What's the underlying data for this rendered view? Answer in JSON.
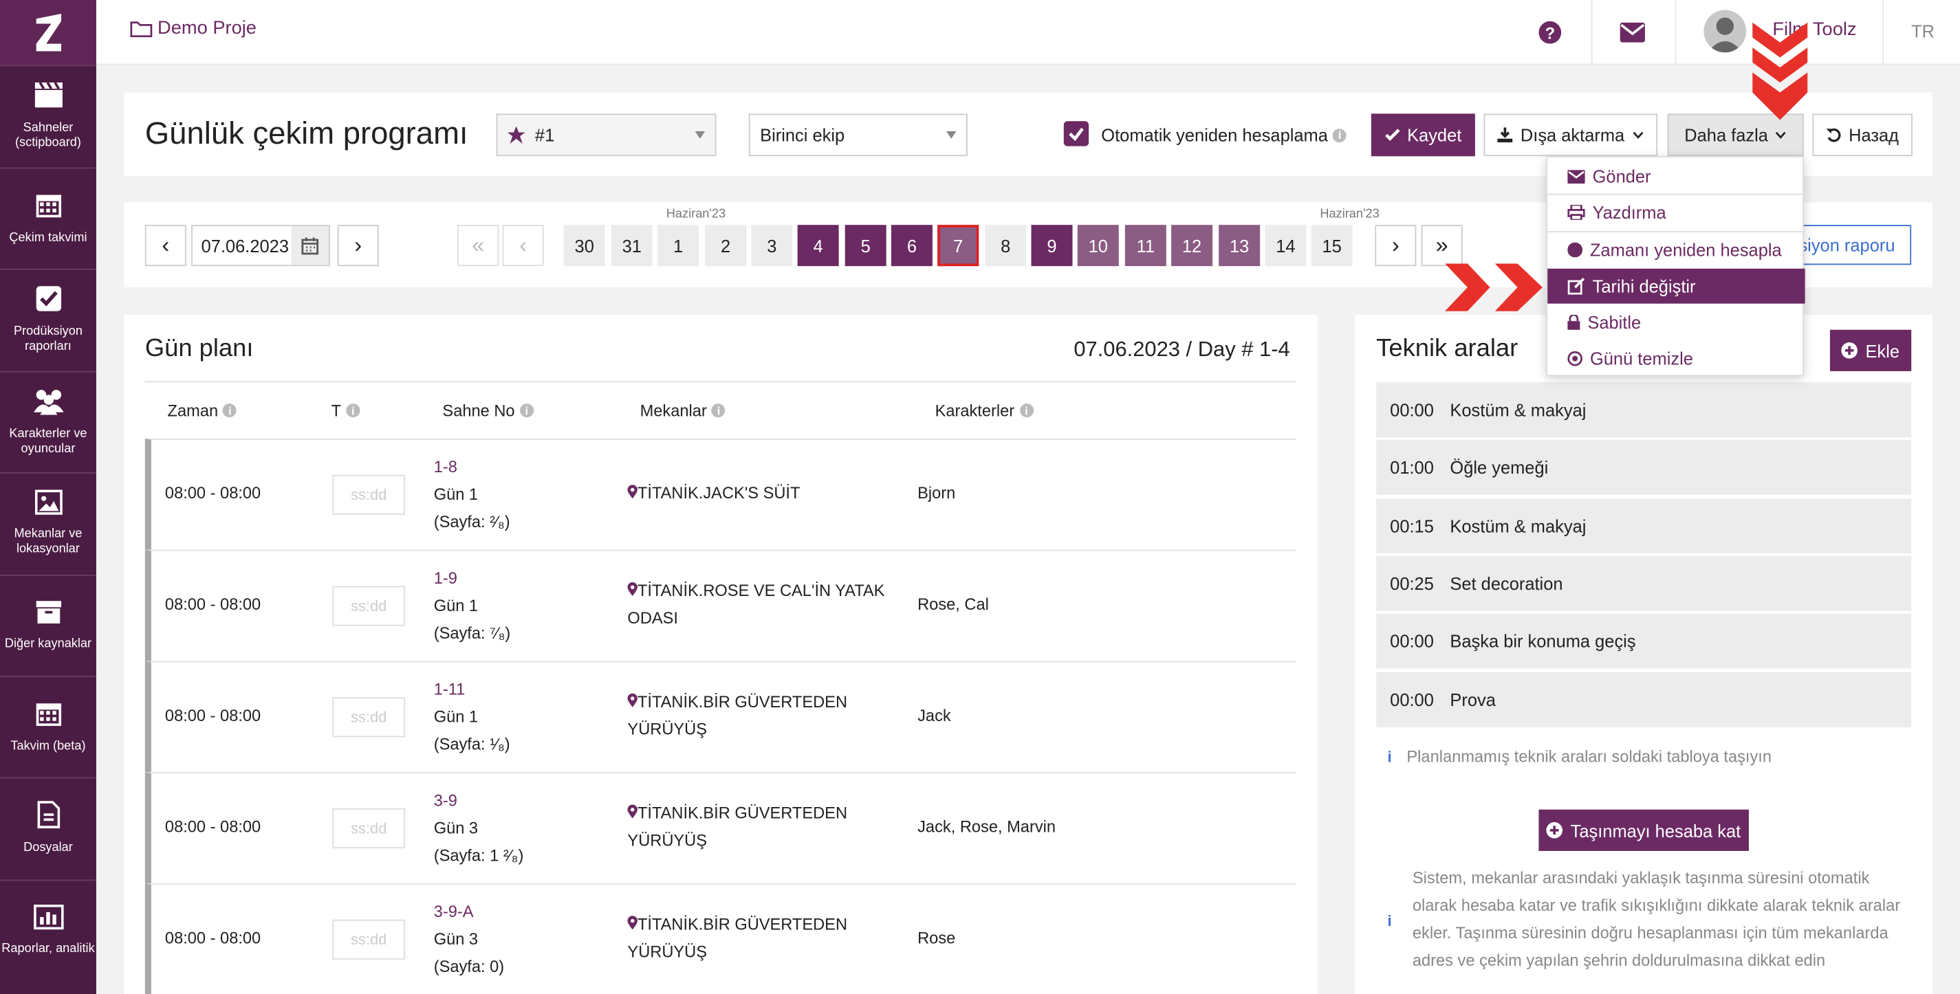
{
  "sidebar": {
    "items": [
      {
        "label": "Sahneler (sctipboard)",
        "icon": "clapperboard-icon"
      },
      {
        "label": "Çekim takvimi",
        "icon": "calendar-icon"
      },
      {
        "label": "Prodüksiyon raporları",
        "icon": "checkbox-icon"
      },
      {
        "label": "Karakterler ve oyuncular",
        "icon": "people-icon"
      },
      {
        "label": "Mekanlar ve lokasyonlar",
        "icon": "image-icon"
      },
      {
        "label": "Diğer kaynaklar",
        "icon": "archive-icon"
      },
      {
        "label": "Takvim (beta)",
        "icon": "calendar-icon"
      },
      {
        "label": "Dosyalar",
        "icon": "file-icon"
      },
      {
        "label": "Raporlar, analitik",
        "icon": "bar-chart-icon"
      }
    ]
  },
  "topbar": {
    "project": "Demo Proje",
    "user": "Film Toolz",
    "lang": "TR"
  },
  "header": {
    "title": "Günlük çekim programı",
    "schedule_select": "#1",
    "team_select": "Birinci ekip",
    "auto_label": "Otomatik yeniden hesaplama",
    "save": "Kaydet",
    "export": "Dışa aktarma",
    "more": "Daha fazla",
    "back": "Назад"
  },
  "dropdown": {
    "items": [
      "Gönder",
      "Yazdırma",
      "Zamanı yeniden hesapla",
      "Tarihi değiştir",
      "Sabitle",
      "Günü temizle"
    ]
  },
  "dates": {
    "date_value": "07.06.2023",
    "month1": "Haziran'23",
    "month2": "Haziran'23",
    "days": [
      "30",
      "31",
      "1",
      "2",
      "3",
      "4",
      "5",
      "6",
      "7",
      "8",
      "9",
      "10",
      "11",
      "12",
      "13",
      "14",
      "15"
    ],
    "report_link": "siyon raporu"
  },
  "plan": {
    "title": "Gün planı",
    "date_day": "07.06.2023 / Day # 1-4",
    "cols": [
      "Zaman",
      "T",
      "Sahne No",
      "Mekanlar",
      "Karakterler"
    ],
    "time_placeholder": "ss:dd",
    "rows": [
      {
        "time": "08:00 - 08:00",
        "scene": "1-8",
        "day": "Gün 1",
        "page": "(Sayfa: ²⁄₈)",
        "location": "TİTANİK.JACK'S SÜİT",
        "location2": "",
        "chars": "Bjorn"
      },
      {
        "time": "08:00 - 08:00",
        "scene": "1-9",
        "day": "Gün 1",
        "page": "(Sayfa: ⁷⁄₈)",
        "location": "TİTANİK.ROSE VE CAL'İN YATAK",
        "location2": "ODASI",
        "chars": "Rose, Cal"
      },
      {
        "time": "08:00 - 08:00",
        "scene": "1-11",
        "day": "Gün 1",
        "page": "(Sayfa: ¹⁄₈)",
        "location": "TİTANİK.BİR GÜVERTEDEN",
        "location2": "YÜRÜYÜŞ",
        "chars": "Jack"
      },
      {
        "time": "08:00 - 08:00",
        "scene": "3-9",
        "day": "Gün 3",
        "page": "(Sayfa: 1 ²⁄₈)",
        "location": "TİTANİK.BİR GÜVERTEDEN",
        "location2": "YÜRÜYÜŞ",
        "chars": "Jack, Rose, Marvin"
      },
      {
        "time": "08:00 - 08:00",
        "scene": "3-9-A",
        "day": "Gün 3",
        "page": "(Sayfa: 0)",
        "location": "TİTANİK.BİR GÜVERTEDEN",
        "location2": "YÜRÜYÜŞ",
        "chars": "Rose"
      }
    ]
  },
  "breaks": {
    "title": "Teknik aralar",
    "add": "Ekle",
    "rows": [
      {
        "t": "00:00",
        "n": "Kostüm & makyaj"
      },
      {
        "t": "01:00",
        "n": "Öğle yemeği"
      },
      {
        "t": "00:15",
        "n": "Kostüm & makyaj"
      },
      {
        "t": "00:25",
        "n": "Set decoration"
      },
      {
        "t": "00:00",
        "n": "Başka bir konuma geçiş"
      },
      {
        "t": "00:00",
        "n": "Prova"
      }
    ],
    "hint": "Planlanmamış teknik araları soldaki tabloya taşıyın",
    "calc": "Taşınmayı hesaba kat",
    "note": [
      "Sistem, mekanlar arasındaki yaklaşık taşınma süresini otomatik",
      "olarak hesaba katar ve trafik sıkışıklığını dikkate alarak teknik aralar",
      "ekler. Taşınma süresinin doğru hesaplanması için tüm mekanlarda",
      "adres ve çekim yapılan şehrin doldurulmasına dikkat edin"
    ]
  },
  "colors": {
    "brand": "#6b2a63",
    "sidebar": "#4b1c43",
    "annotation": "#e8302a"
  }
}
